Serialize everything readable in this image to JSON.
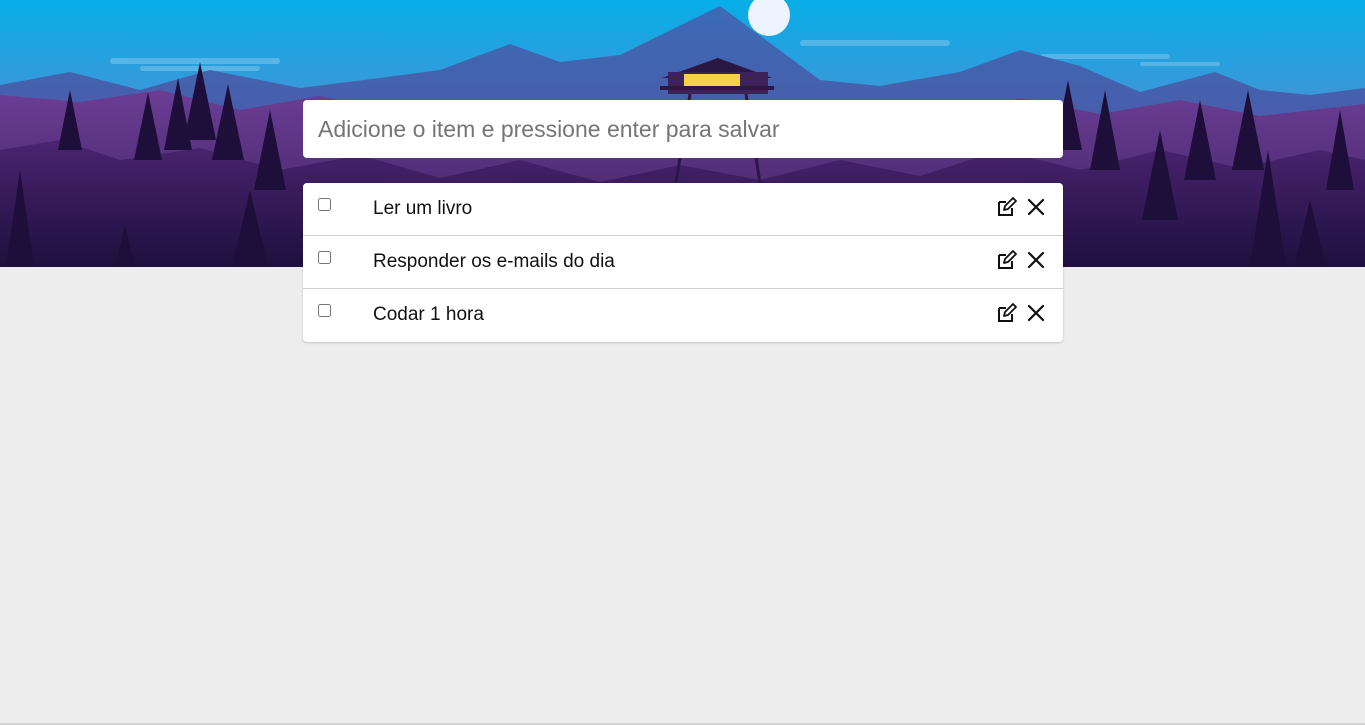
{
  "new_item": {
    "placeholder": "Adicione o item e pressione enter para salvar",
    "value": ""
  },
  "todos": [
    {
      "text": "Ler um livro",
      "checked": false
    },
    {
      "text": "Responder os e-mails do dia",
      "checked": false
    },
    {
      "text": "Codar 1 hora",
      "checked": false
    }
  ],
  "icons": {
    "edit": "edit-icon",
    "delete": "close-icon"
  },
  "colors": {
    "page_background": "#ededed",
    "sky_top": "#0ab0ea",
    "mountains_far": "#3f6fb8",
    "forest": "#3b1f63",
    "moon": "#f3f7ff"
  }
}
